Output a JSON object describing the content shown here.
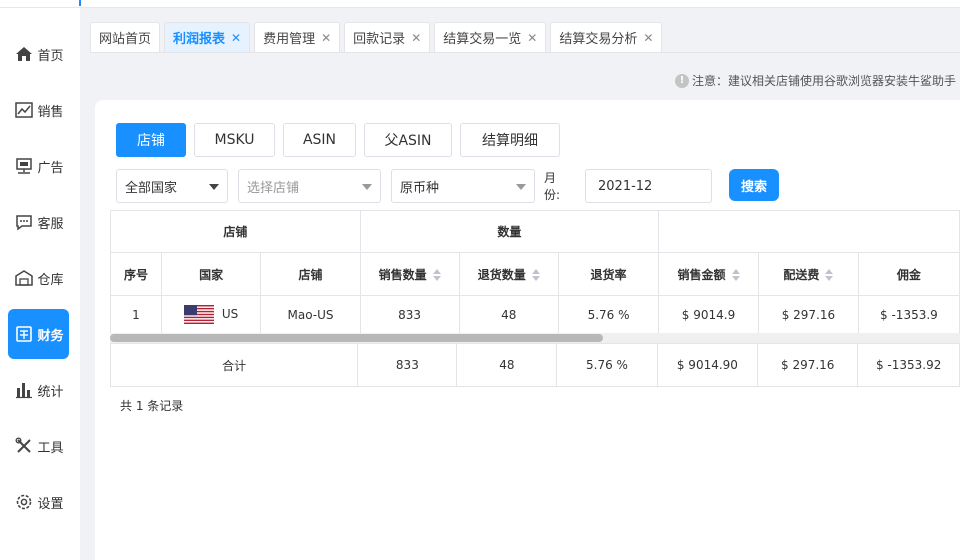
{
  "sidebar": {
    "items": [
      {
        "label": "首页",
        "icon": "home-icon",
        "active": false
      },
      {
        "label": "销售",
        "icon": "trend-chart-icon",
        "active": false
      },
      {
        "label": "广告",
        "icon": "ad-icon",
        "active": false
      },
      {
        "label": "客服",
        "icon": "chat-icon",
        "active": false
      },
      {
        "label": "仓库",
        "icon": "warehouse-icon",
        "active": false
      },
      {
        "label": "财务",
        "icon": "finance-icon",
        "active": true
      },
      {
        "label": "统计",
        "icon": "bar-chart-icon",
        "active": false
      },
      {
        "label": "工具",
        "icon": "tools-icon",
        "active": false
      },
      {
        "label": "设置",
        "icon": "gear-icon",
        "active": false
      }
    ]
  },
  "tabs": [
    {
      "label": "网站首页",
      "closable": false,
      "active": false
    },
    {
      "label": "利润报表",
      "closable": true,
      "active": true
    },
    {
      "label": "费用管理",
      "closable": true,
      "active": false
    },
    {
      "label": "回款记录",
      "closable": true,
      "active": false
    },
    {
      "label": "结算交易一览",
      "closable": true,
      "active": false
    },
    {
      "label": "结算交易分析",
      "closable": true,
      "active": false
    }
  ],
  "close_glyph": "✕",
  "notice": {
    "icon": "!",
    "text": "注意：建议相关店铺使用谷歌浏览器安装牛鲨助手"
  },
  "sub_tabs": [
    "店铺",
    "MSKU",
    "ASIN",
    "父ASIN",
    "结算明细"
  ],
  "filters": {
    "country": "全部国家",
    "store_placeholder": "选择店铺",
    "currency": "原币种",
    "month_label": "月份:",
    "month_value": "2021-12",
    "search_label": "搜索"
  },
  "table": {
    "group_headers": [
      "店铺",
      "数量"
    ],
    "columns": [
      "序号",
      "国家",
      "店铺",
      "销售数量",
      "退货数量",
      "退货率",
      "销售金额",
      "配送费",
      "佣金"
    ],
    "rows": [
      {
        "index": "1",
        "country": "US",
        "store": "Mao-US",
        "sales_qty": "833",
        "return_qty": "48",
        "return_rate": "5.76 %",
        "sales_amount": "$ 9014.9",
        "shipping": "$ 297.16",
        "commission": "$ -1353.9"
      }
    ],
    "totals": {
      "label": "合计",
      "sales_qty": "833",
      "return_qty": "48",
      "return_rate": "5.76 %",
      "sales_amount": "$ 9014.90",
      "shipping": "$ 297.16",
      "commission": "$ -1353.92"
    },
    "scroll_position": 0.58
  },
  "record_count": "共 1 条记录",
  "colors": {
    "accent": "#1890ff"
  }
}
